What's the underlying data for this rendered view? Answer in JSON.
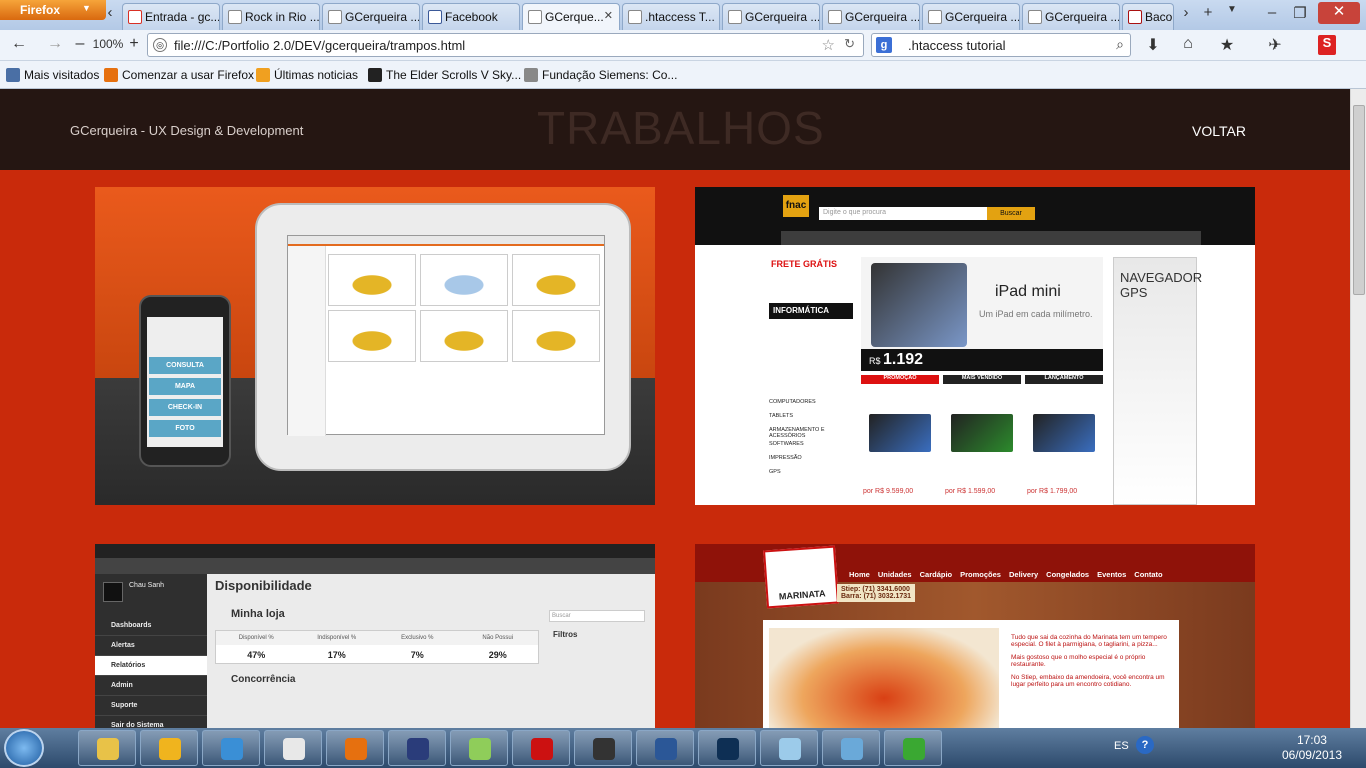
{
  "browser": {
    "app_button": "Firefox",
    "tabs": [
      {
        "label": "Entrada - gc...",
        "icon": "gmail-icon",
        "color": "#d93025"
      },
      {
        "label": "Rock in Rio ...",
        "icon": "page-icon",
        "color": "#888"
      },
      {
        "label": "GCerqueira ...",
        "icon": "page-icon",
        "color": "#888"
      },
      {
        "label": "Facebook",
        "icon": "facebook-icon",
        "color": "#3b5998"
      },
      {
        "label": "GCerque...",
        "icon": "page-icon",
        "color": "#888",
        "active": true
      },
      {
        "label": ".htaccess T...",
        "icon": "page-icon",
        "color": "#888"
      },
      {
        "label": "GCerqueira ...",
        "icon": "page-icon",
        "color": "#888"
      },
      {
        "label": "GCerqueira ...",
        "icon": "page-icon",
        "color": "#888"
      },
      {
        "label": "GCerqueira ...",
        "icon": "page-icon",
        "color": "#888"
      },
      {
        "label": "GCerqueira ...",
        "icon": "page-icon",
        "color": "#888"
      },
      {
        "label": "Bacor",
        "icon": "page-icon",
        "color": "#a11"
      }
    ],
    "zoom": "100%",
    "url": "file:///C:/Portfolio 2.0/DEV/gcerqueira/trampos.html",
    "search_value": ".htaccess tutorial",
    "bookmarks": [
      {
        "label": "Mais visitados",
        "icon": "globe-icon"
      },
      {
        "label": "Comenzar a usar Firefox",
        "icon": "firefox-icon"
      },
      {
        "label": "Últimas noticias",
        "icon": "rss-icon"
      },
      {
        "label": "The Elder Scrolls V Sky...",
        "icon": "skyrim-icon"
      },
      {
        "label": "Fundação Siemens: Co...",
        "icon": "page-icon"
      }
    ]
  },
  "site": {
    "brand": "GCerqueira - UX Design & Development",
    "title": "TRABALHOS",
    "back_label": "VOLTAR",
    "bg": "#c92a0b",
    "header_bg": "#251612"
  },
  "cards": {
    "c1": {
      "app_buttons": [
        "CONSULTA",
        "MAPA",
        "CHECK-IN",
        "FOTO"
      ]
    },
    "c2": {
      "search_placeholder": "Digite o que procura",
      "search_btn": "Buscar",
      "product": "iPad mini",
      "tagline": "Um iPad em cada milímetro.",
      "price": "1.192",
      "sidebar_title": "INFORMÁTICA",
      "menu": [
        "COMPUTADORES",
        "TABLETS",
        "ARMAZENAMENTO E ACESSÓRIOS",
        "SOFTWARES",
        "IMPRESSÃO",
        "GPS"
      ],
      "ad": "NAVEGADOR GPS",
      "badges": [
        "PROMOÇÃO",
        "MAIS VENDIDO",
        "LANÇAMENTO"
      ],
      "prices": [
        "por R$ 9.599,00",
        "por R$ 1.599,00",
        "por R$ 1.799,00"
      ]
    },
    "c3": {
      "title": "Disponibilidade",
      "user": "Chau Sanh",
      "nav": [
        "Dashboards",
        "Alertas",
        "Relatórios",
        "Admin",
        "Suporte",
        "Sair do Sistema"
      ],
      "section": "Minha loja",
      "headers": [
        "Disponível %",
        "Indisponível %",
        "Exclusivo %",
        "Não Possui"
      ],
      "values": [
        "47%",
        "17%",
        "7%",
        "29%"
      ],
      "section2": "Concorrência",
      "filters": "Filtros",
      "search": "Buscar"
    },
    "c4": {
      "logo": "MARINATA",
      "nav": [
        "Home",
        "Unidades",
        "Cardápio",
        "Promoções",
        "Delivery",
        "Congelados",
        "Eventos",
        "Contato"
      ],
      "phone1": "Stiep: (71) 3341.6000",
      "phone2": "Barra: (71) 3032.1731",
      "text1": "Tudo que sai da cozinha do Marinata tem um tempero especial. O filet à parmigiana, o tagliarini, a pizza...",
      "text2": "Mais gostoso que o molho especial é o próprio restaurante.",
      "text3": "No Stiep, embaixo da amendoeira, você encontra um lugar perfeito para um encontro cotidiano."
    }
  },
  "taskbar": {
    "apps": [
      "explorer",
      "winamp",
      "network",
      "chrome",
      "firefox",
      "kmplayer",
      "notepad++",
      "acrobat",
      "steam",
      "word",
      "photoshop",
      "notes",
      "photos",
      "utorrent"
    ],
    "lang": "ES",
    "time": "17:03",
    "date": "06/09/2013"
  }
}
